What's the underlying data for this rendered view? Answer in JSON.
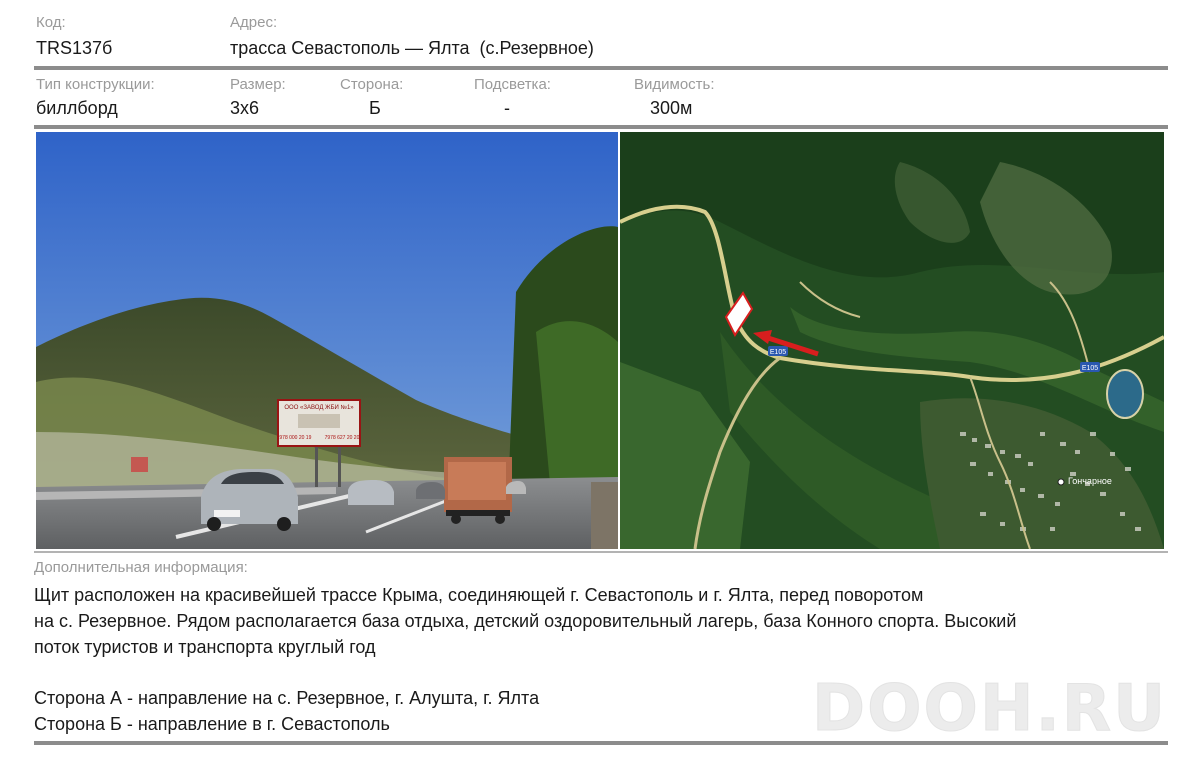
{
  "code": {
    "label": "Код:",
    "value": "TRS137б"
  },
  "address": {
    "label": "Адрес:",
    "value": "трасса Севастополь — Ялта  (с.Резервное)"
  },
  "construction_type": {
    "label": "Тип конструкции:",
    "value": "биллборд"
  },
  "size": {
    "label": "Размер:",
    "value": "3х6"
  },
  "side": {
    "label": "Сторона:",
    "value": "Б"
  },
  "lighting": {
    "label": "Подсветка:",
    "value": "-"
  },
  "visibility": {
    "label": "Видимость:",
    "value": "300м"
  },
  "photo": {
    "billboard_lines": [
      "ООО «ЗАВОД ЖБИ №1»",
      "7978 000 20 19",
      "7978 627 20 20"
    ],
    "truck_plate": "",
    "car_plate": ""
  },
  "map": {
    "village_label": "Гончарное",
    "road_badge_1": "Е105",
    "road_badge_2": "Е105"
  },
  "additional_info": {
    "label": "Дополнительная информация:",
    "lines": [
      "Щит расположен на красивейшей трассе Крыма, соединяющей г. Севастополь и г. Ялта, перед поворотом",
      "на с. Резервное. Рядом располагается база отдыха, детский оздоровительный лагерь, база Конного спорта. Высокий",
      "поток туристов и транспорта круглый год"
    ],
    "side_a": "Сторона А - направление на с. Резервное, г. Алушта, г. Ялта",
    "side_b": "Сторона Б - направление в г. Севастополь"
  },
  "watermark": "DOOH.RU",
  "colors": {
    "rule": "#8c8c8c",
    "label": "#9a9a9a",
    "arrow": "#d81e1e"
  }
}
